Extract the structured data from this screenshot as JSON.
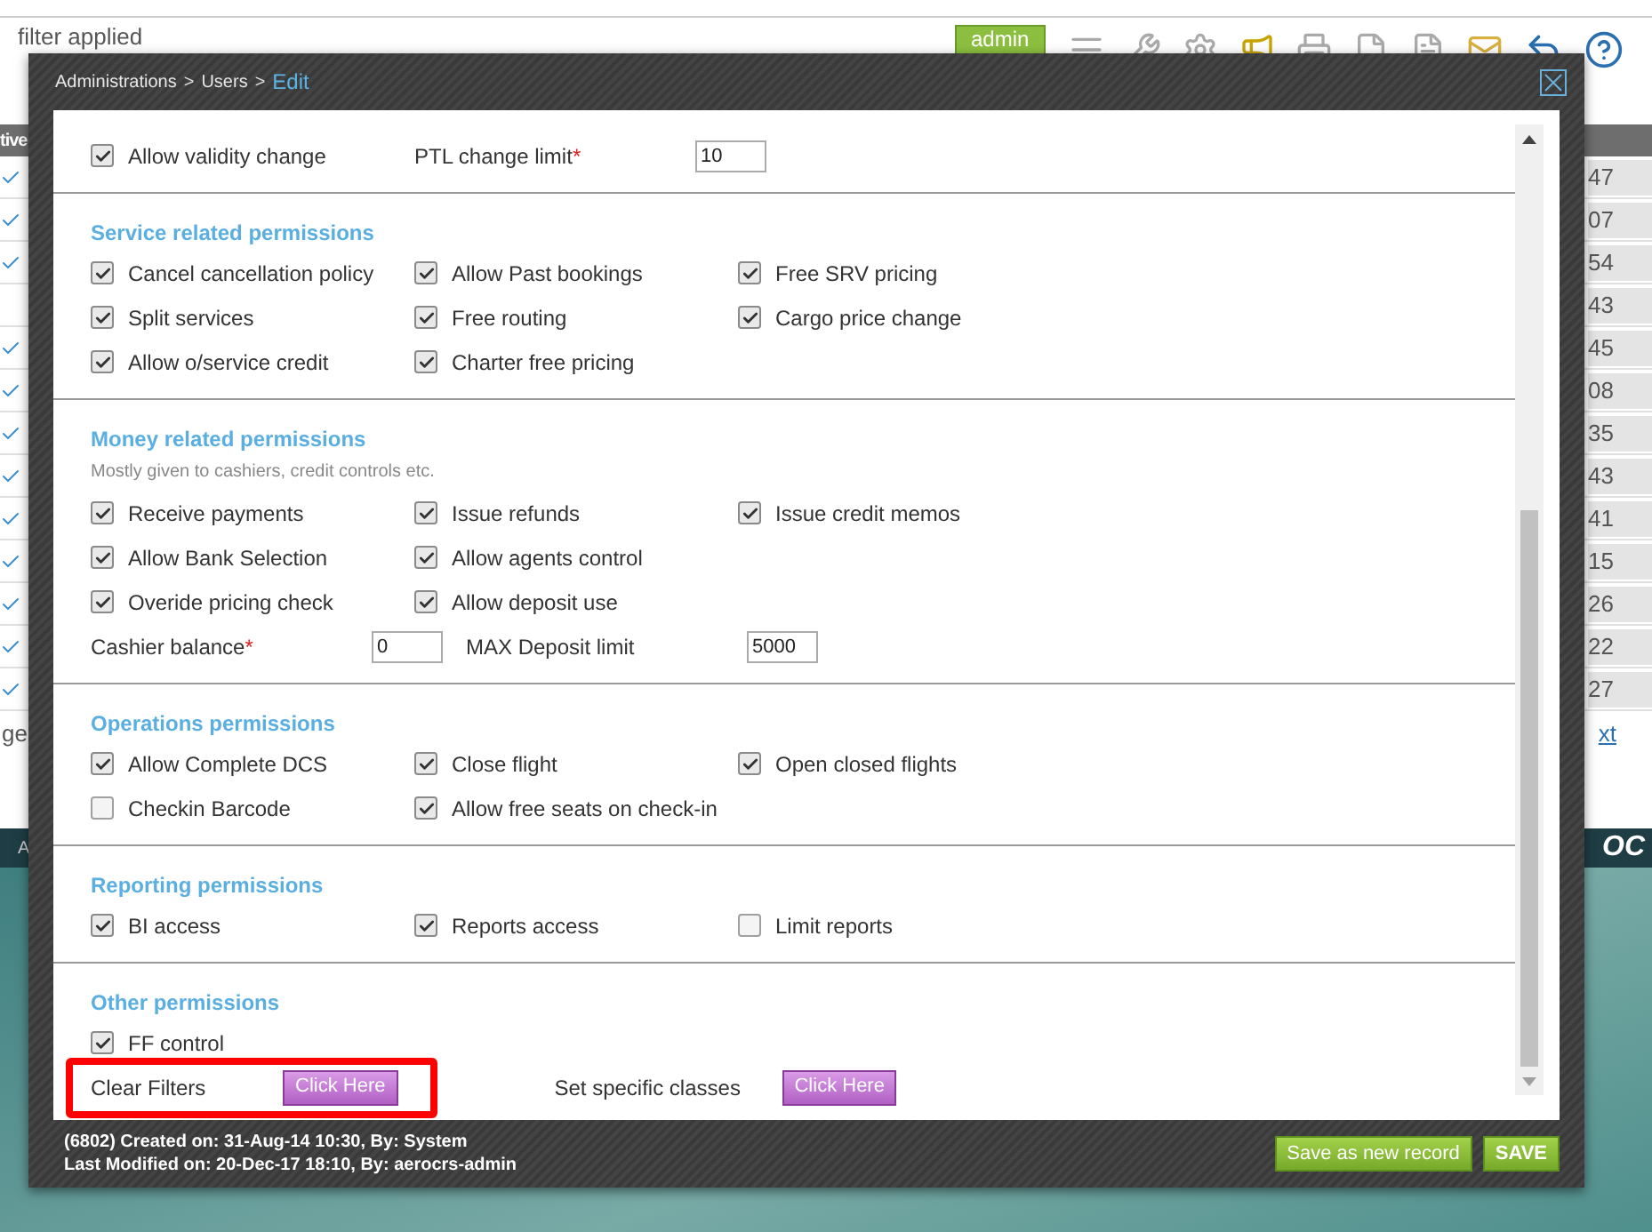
{
  "background": {
    "filter_text": "filter applied",
    "user_badge": "admin",
    "table": {
      "header": "tive",
      "rows": [
        {
          "checked": true,
          "value": "47"
        },
        {
          "checked": true,
          "value": "07"
        },
        {
          "checked": true,
          "value": "54"
        },
        {
          "checked": false,
          "value": "43"
        },
        {
          "checked": true,
          "value": "45"
        },
        {
          "checked": true,
          "value": "08"
        },
        {
          "checked": true,
          "value": "35"
        },
        {
          "checked": true,
          "value": "43"
        },
        {
          "checked": true,
          "value": "41"
        },
        {
          "checked": true,
          "value": "15"
        },
        {
          "checked": true,
          "value": "26"
        },
        {
          "checked": true,
          "value": "22"
        },
        {
          "checked": true,
          "value": "27"
        }
      ]
    },
    "pager_left": "ge",
    "pager_right": "xt",
    "band_text": "A",
    "logo_text": "OC"
  },
  "dialog": {
    "required_mark": "*",
    "breadcrumb": {
      "separator": ">",
      "items": [
        {
          "label": "Administrations",
          "selected": false
        },
        {
          "label": "Users",
          "selected": false
        },
        {
          "label": "Edit",
          "selected": true
        }
      ]
    },
    "sections": [
      {
        "rows": [
          [
            {
              "kind": "checkbox",
              "label": "Allow validity change",
              "checked": true
            },
            {
              "kind": "field",
              "label": "PTL change limit",
              "required": true,
              "value": "10"
            }
          ]
        ]
      },
      {
        "title": "Service related permissions",
        "rows": [
          [
            {
              "kind": "checkbox",
              "label": "Cancel cancellation policy",
              "checked": true
            },
            {
              "kind": "checkbox",
              "label": "Allow Past bookings",
              "checked": true
            },
            {
              "kind": "checkbox",
              "label": "Free SRV pricing",
              "checked": true
            }
          ],
          [
            {
              "kind": "checkbox",
              "label": "Split services",
              "checked": true
            },
            {
              "kind": "checkbox",
              "label": "Free routing",
              "checked": true
            },
            {
              "kind": "checkbox",
              "label": "Cargo price change",
              "checked": true
            }
          ],
          [
            {
              "kind": "checkbox",
              "label": "Allow o/service credit",
              "checked": true
            },
            {
              "kind": "checkbox",
              "label": "Charter free pricing",
              "checked": true
            }
          ]
        ]
      },
      {
        "title": "Money related permissions",
        "subtitle": "Mostly given to cashiers, credit controls etc.",
        "rows": [
          [
            {
              "kind": "checkbox",
              "label": "Receive payments",
              "checked": true
            },
            {
              "kind": "checkbox",
              "label": "Issue refunds",
              "checked": true
            },
            {
              "kind": "checkbox",
              "label": "Issue credit memos",
              "checked": true
            }
          ],
          [
            {
              "kind": "checkbox",
              "label": "Allow Bank Selection",
              "checked": true
            },
            {
              "kind": "checkbox",
              "label": "Allow agents control",
              "checked": true
            }
          ],
          [
            {
              "kind": "checkbox",
              "label": "Overide pricing check",
              "checked": true
            },
            {
              "kind": "checkbox",
              "label": "Allow deposit use",
              "checked": true
            }
          ],
          [
            {
              "kind": "field",
              "label": "Cashier balance",
              "required": true,
              "value": "0"
            },
            {
              "kind": "field",
              "label": "MAX Deposit limit",
              "required": false,
              "value": "5000"
            }
          ]
        ]
      },
      {
        "title": "Operations permissions",
        "rows": [
          [
            {
              "kind": "checkbox",
              "label": "Allow Complete DCS",
              "checked": true
            },
            {
              "kind": "checkbox",
              "label": "Close flight",
              "checked": true
            },
            {
              "kind": "checkbox",
              "label": "Open closed flights",
              "checked": true
            }
          ],
          [
            {
              "kind": "checkbox",
              "label": "Checkin Barcode",
              "checked": false
            },
            {
              "kind": "checkbox",
              "label": "Allow free seats on check-in",
              "checked": true
            }
          ]
        ]
      },
      {
        "title": "Reporting permissions",
        "rows": [
          [
            {
              "kind": "checkbox",
              "label": "BI access",
              "checked": true
            },
            {
              "kind": "checkbox",
              "label": "Reports access",
              "checked": true
            },
            {
              "kind": "checkbox",
              "label": "Limit reports",
              "checked": false
            }
          ]
        ]
      },
      {
        "title": "Other permissions",
        "rows": [
          [
            {
              "kind": "checkbox",
              "label": "FF control",
              "checked": true
            }
          ],
          [
            {
              "kind": "action",
              "label": "Clear Filters",
              "button": "Click Here",
              "highlighted": true
            },
            {
              "kind": "action",
              "label": "Set specific classes",
              "button": "Click Here",
              "highlighted": false
            }
          ]
        ]
      }
    ],
    "footer": {
      "lines": [
        "(6802) Created on: 31-Aug-14 10:30, By: System",
        "Last Modified on: 20-Dec-17 18:10, By: aerocrs-admin"
      ],
      "buttons": [
        "Save as new record",
        "SAVE"
      ]
    }
  }
}
